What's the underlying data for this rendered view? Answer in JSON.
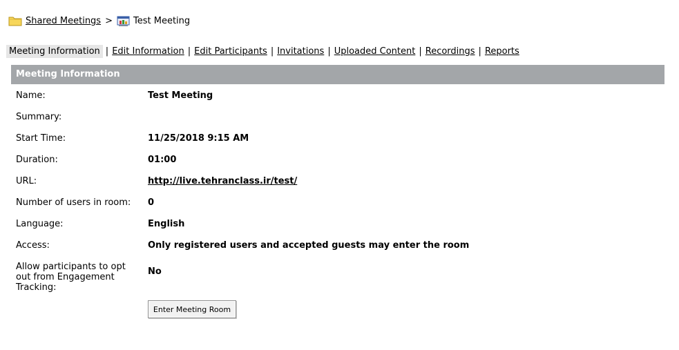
{
  "breadcrumb": {
    "parent_label": "Shared Meetings",
    "separator": ">",
    "current_label": "Test Meeting"
  },
  "tabs": [
    {
      "label": "Meeting Information",
      "active": true
    },
    {
      "label": "Edit Information",
      "active": false
    },
    {
      "label": "Edit Participants",
      "active": false
    },
    {
      "label": "Invitations",
      "active": false
    },
    {
      "label": "Uploaded Content",
      "active": false
    },
    {
      "label": "Recordings",
      "active": false
    },
    {
      "label": "Reports",
      "active": false
    }
  ],
  "tab_separator": "|",
  "panel": {
    "title": "Meeting Information"
  },
  "fields": {
    "name": {
      "label": "Name:",
      "value": "Test Meeting"
    },
    "summary": {
      "label": "Summary:",
      "value": ""
    },
    "start_time": {
      "label": "Start Time:",
      "value": "11/25/2018 9:15 AM"
    },
    "duration": {
      "label": "Duration:",
      "value": "01:00"
    },
    "url": {
      "label": "URL:",
      "value": "http://live.tehranclass.ir/test/"
    },
    "users": {
      "label": "Number of users in room:",
      "value": "0"
    },
    "language": {
      "label": "Language:",
      "value": "English"
    },
    "access": {
      "label": "Access:",
      "value": "Only registered users and accepted guests may enter the room"
    },
    "opt_out": {
      "label": "Allow participants to opt out from Engagement Tracking:",
      "value": "No"
    }
  },
  "enter_button_label": "Enter Meeting Room",
  "colors": {
    "panel_header_bg": "#a3a6a9",
    "active_tab_bg": "#e6e6e6"
  },
  "icons": {
    "parent": "folder-icon",
    "current": "meeting-icon"
  }
}
